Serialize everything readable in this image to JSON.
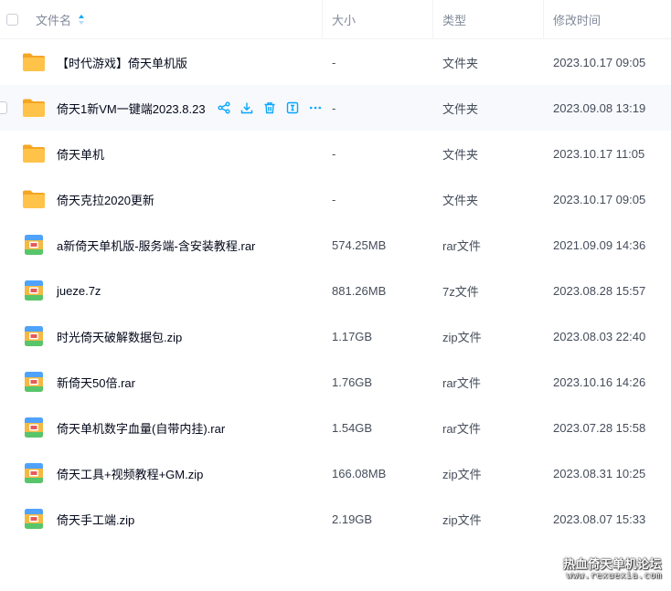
{
  "header": {
    "name": "文件名",
    "size": "大小",
    "type": "类型",
    "modified": "修改时间"
  },
  "icons": {
    "folder": "folder-icon",
    "archive": "archive-icon",
    "share": "share-icon",
    "download": "download-icon",
    "delete": "trash-icon",
    "rename": "rename-icon",
    "more": "more-icon"
  },
  "colors": {
    "accent": "#06a7ff",
    "folder": "#ffc34a",
    "text": "#03081a",
    "muted": "#818999"
  },
  "files": [
    {
      "name": "【时代游戏】倚天单机版",
      "size": "-",
      "type": "文件夹",
      "modified": "2023.10.17 09:05",
      "kind": "folder"
    },
    {
      "name": "倚天1新VM一键端2023.8.23",
      "size": "-",
      "type": "文件夹",
      "modified": "2023.09.08 13:19",
      "kind": "folder"
    },
    {
      "name": "倚天单机",
      "size": "-",
      "type": "文件夹",
      "modified": "2023.10.17 11:05",
      "kind": "folder"
    },
    {
      "name": "倚天克拉2020更新",
      "size": "-",
      "type": "文件夹",
      "modified": "2023.10.17 09:05",
      "kind": "folder"
    },
    {
      "name": "a新倚天单机版-服务端-含安装教程.rar",
      "size": "574.25MB",
      "type": "rar文件",
      "modified": "2021.09.09 14:36",
      "kind": "archive"
    },
    {
      "name": "jueze.7z",
      "size": "881.26MB",
      "type": "7z文件",
      "modified": "2023.08.28 15:57",
      "kind": "archive"
    },
    {
      "name": "时光倚天破解数据包.zip",
      "size": "1.17GB",
      "type": "zip文件",
      "modified": "2023.08.03 22:40",
      "kind": "archive"
    },
    {
      "name": "新倚天50倍.rar",
      "size": "1.76GB",
      "type": "rar文件",
      "modified": "2023.10.16 14:26",
      "kind": "archive"
    },
    {
      "name": "倚天单机数字血量(自带内挂).rar",
      "size": "1.54GB",
      "type": "rar文件",
      "modified": "2023.07.28 15:58",
      "kind": "archive"
    },
    {
      "name": "倚天工具+视频教程+GM.zip",
      "size": "166.08MB",
      "type": "zip文件",
      "modified": "2023.08.31 10:25",
      "kind": "archive"
    },
    {
      "name": "倚天手工端.zip",
      "size": "2.19GB",
      "type": "zip文件",
      "modified": "2023.08.07 15:33",
      "kind": "archive"
    }
  ],
  "watermark": {
    "line1": "热血倚天单机论坛",
    "line2": "www.rexuexia.com"
  }
}
